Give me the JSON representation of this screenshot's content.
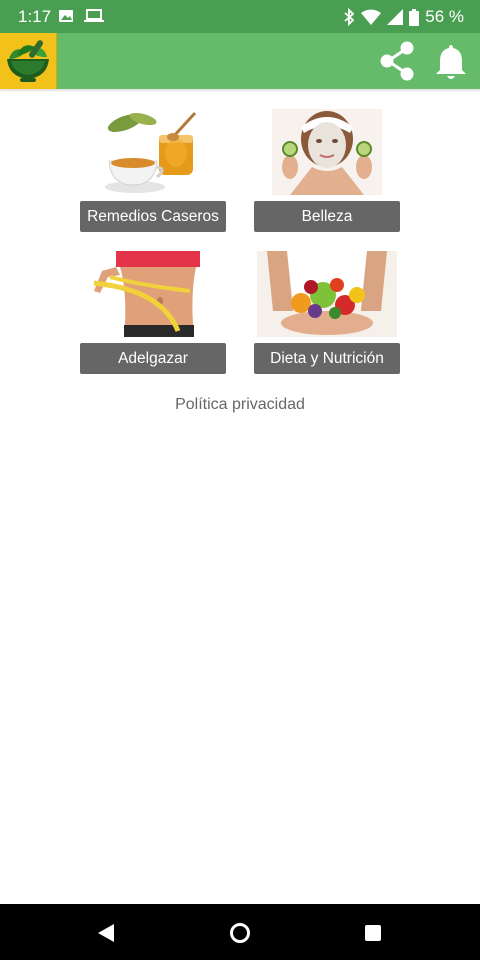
{
  "status_bar": {
    "time": "1:17",
    "battery_text": "56 %",
    "icons": [
      "image-icon",
      "laptop-icon",
      "bluetooth-icon",
      "wifi-icon",
      "signal-icon",
      "battery-icon"
    ]
  },
  "app_bar": {
    "logo_icon": "mortar-pestle-herbs-logo",
    "share_icon": "share-icon",
    "bell_icon": "bell-icon",
    "colors": {
      "status_bar": "#4a9e52",
      "app_bar": "#66bb6a",
      "logo_bg": "#f2c21a"
    }
  },
  "categories": [
    {
      "label": "Remedios Caseros",
      "image": "tea-honey-image"
    },
    {
      "label": "Belleza",
      "image": "face-mask-image"
    },
    {
      "label": "Adelgazar",
      "image": "waist-measure-image"
    },
    {
      "label": "Dieta y Nutrición",
      "image": "fruits-hands-image"
    }
  ],
  "privacy": {
    "label": "Política privacidad"
  },
  "nav_bar": {
    "back_icon": "back-icon",
    "home_icon": "home-icon",
    "recents_icon": "recents-icon"
  }
}
